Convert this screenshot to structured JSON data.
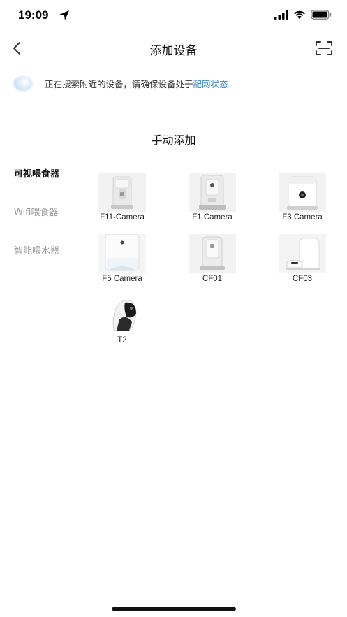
{
  "status": {
    "time": "19:09"
  },
  "nav": {
    "title": "添加设备"
  },
  "search": {
    "text": "正在搜索附近的设备，请确保设备处于",
    "link": "配网状态"
  },
  "section_title": "手动添加",
  "categories": [
    {
      "label": "可视喂食器",
      "active": true
    },
    {
      "label": "Wifi喂食器",
      "active": false
    },
    {
      "label": "智能喂水器",
      "active": false
    }
  ],
  "devices": [
    {
      "label": "F11-Camera",
      "icon": "feeder-camera-icon"
    },
    {
      "label": "F1 Camera",
      "icon": "feeder-camera-icon"
    },
    {
      "label": "F3 Camera",
      "icon": "feeder-camera-icon"
    },
    {
      "label": "F5 Camera",
      "icon": "feeder-camera-icon"
    },
    {
      "label": "CF01",
      "icon": "feeder-icon"
    },
    {
      "label": "CF03",
      "icon": "feeder-icon"
    },
    {
      "label": "T2",
      "icon": "pet-device-icon"
    }
  ],
  "colors": {
    "link": "#3a86d6",
    "active_text": "#111111",
    "inactive_text": "#999999"
  }
}
